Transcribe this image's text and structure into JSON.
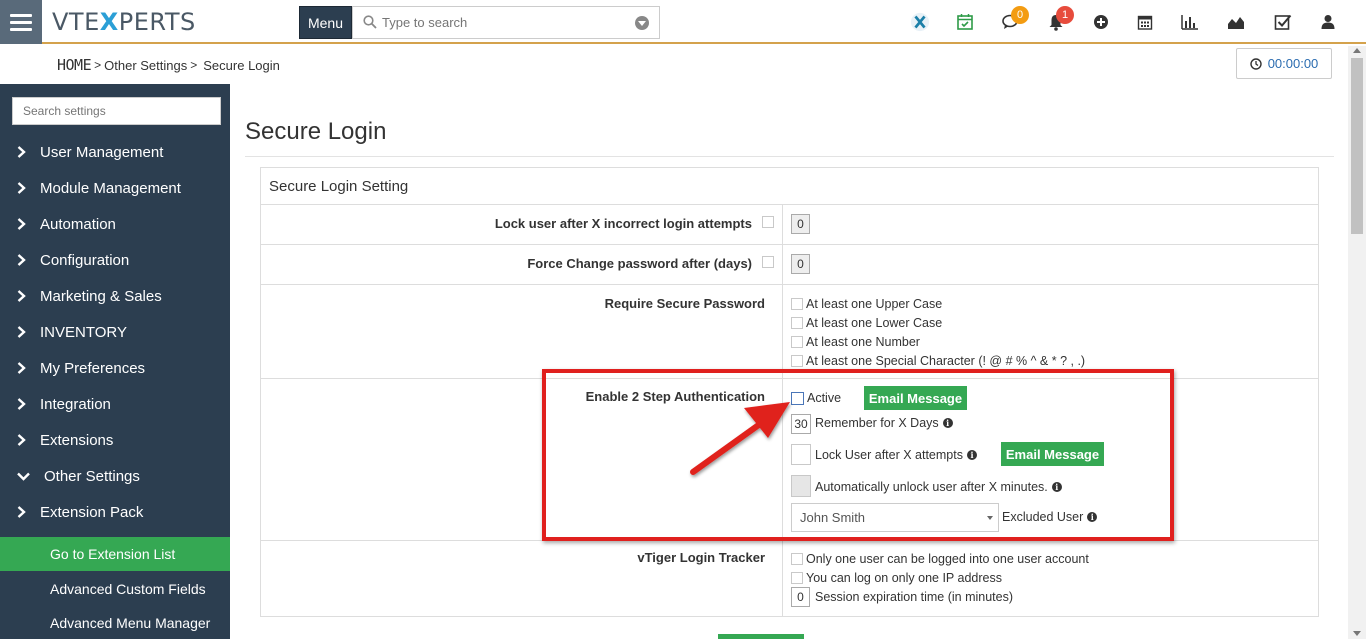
{
  "header": {
    "logo_left": "VTE",
    "logo_x": "X",
    "logo_right": "PERTS",
    "menu_label": "Menu",
    "search_placeholder": "Type to search",
    "badges": {
      "chat": "0",
      "notifications": "1"
    }
  },
  "breadcrumb": {
    "home": "HOME",
    "sep": ">",
    "level1": "Other Settings",
    "level2": "Secure Login"
  },
  "timer": "00:00:00",
  "sidebar": {
    "search_placeholder": "Search settings",
    "items": [
      "User Management",
      "Module Management",
      "Automation",
      "Configuration",
      "Marketing & Sales",
      "INVENTORY",
      "My Preferences",
      "Integration",
      "Extensions",
      "Other Settings",
      "Extension Pack"
    ],
    "sub_items": [
      "Go to Extension List",
      "Advanced Custom Fields",
      "Advanced Menu Manager"
    ]
  },
  "page": {
    "title": "Secure Login",
    "panel_title": "Secure Login Setting",
    "rows": {
      "lock_user": {
        "label": "Lock user after X incorrect login attempts",
        "value": "0"
      },
      "force_change": {
        "label": "Force Change password after (days)",
        "value": "0"
      },
      "require_secure": {
        "label": "Require Secure Password",
        "options": [
          "At least one Upper Case",
          "At least one Lower Case",
          "At least one Number",
          "At least one Special Character (! @ # % ^ & * ? , .)"
        ]
      },
      "two_step": {
        "label": "Enable 2 Step Authentication",
        "active_label": "Active",
        "email_button": "Email Message",
        "remember_value": "30",
        "remember_label": "Remember for X Days",
        "lock_label": "Lock User after X attempts",
        "email_button_2": "Email Message",
        "unlock_label": "Automatically unlock user after X minutes.",
        "excluded_value": "John Smith",
        "excluded_label": "Excluded User"
      },
      "login_tracker": {
        "label": "vTiger Login Tracker",
        "option1": "Only one user can be logged into one user account",
        "option2": "You can log on only one IP address",
        "session_value": "0",
        "session_label": "Session expiration time (in minutes)"
      }
    }
  }
}
